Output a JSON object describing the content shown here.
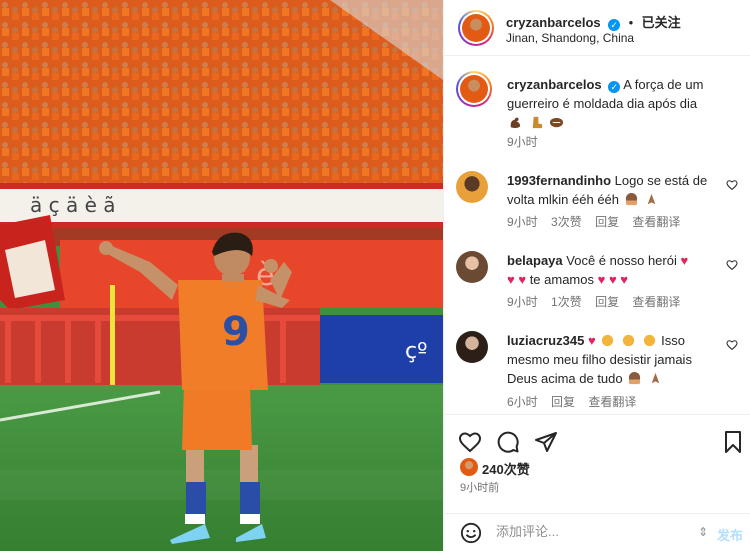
{
  "post": {
    "author": {
      "username": "cryzanbarcelos",
      "verified": true,
      "follow_status": "已关注",
      "separator": "•"
    },
    "location": "Jinan, Shandong, China",
    "caption": {
      "username": "cryzanbarcelos",
      "text": "A força de um guerreiro é moldada dia após dia",
      "emojis": [
        "flexed-biceps",
        "boot",
        "football"
      ],
      "time": "9小时"
    },
    "comments": [
      {
        "username": "1993fernandinho",
        "text": "Logo se está de volta mlkin ééh ééh",
        "emojis_after": [
          "hugging-face",
          "folded-hands"
        ],
        "time": "9小时",
        "likes": "3次赞",
        "reply": "回复",
        "translate": "查看翻译"
      },
      {
        "username": "belapaya",
        "text_part1": "Você é nosso herói",
        "text_part2": "te amamos",
        "time": "9小时",
        "likes": "1次赞",
        "reply": "回复",
        "translate": "查看翻译"
      },
      {
        "username": "luziacruz345",
        "text_part1": "Isso",
        "text_part2": "mesmo meu filho desistir jamais",
        "text_part3": "Deus acima de tudo",
        "time": "6小时",
        "reply": "回复",
        "translate": "查看翻译"
      }
    ],
    "likes_count": "240次赞",
    "posted_ago": "9小时前"
  },
  "composer": {
    "placeholder": "添加评论...",
    "post_label": "发布"
  },
  "colors": {
    "verified": "#0095f6",
    "heart_red": "#e0245e",
    "meta_gray": "#737373",
    "jersey_orange": "#f07a26",
    "pitch_green": "#3f8f3c"
  },
  "icons": {
    "like": "heart-icon",
    "comment": "comment-bubble-icon",
    "share": "paper-plane-icon",
    "save": "bookmark-icon",
    "emoji": "smiley-icon"
  }
}
